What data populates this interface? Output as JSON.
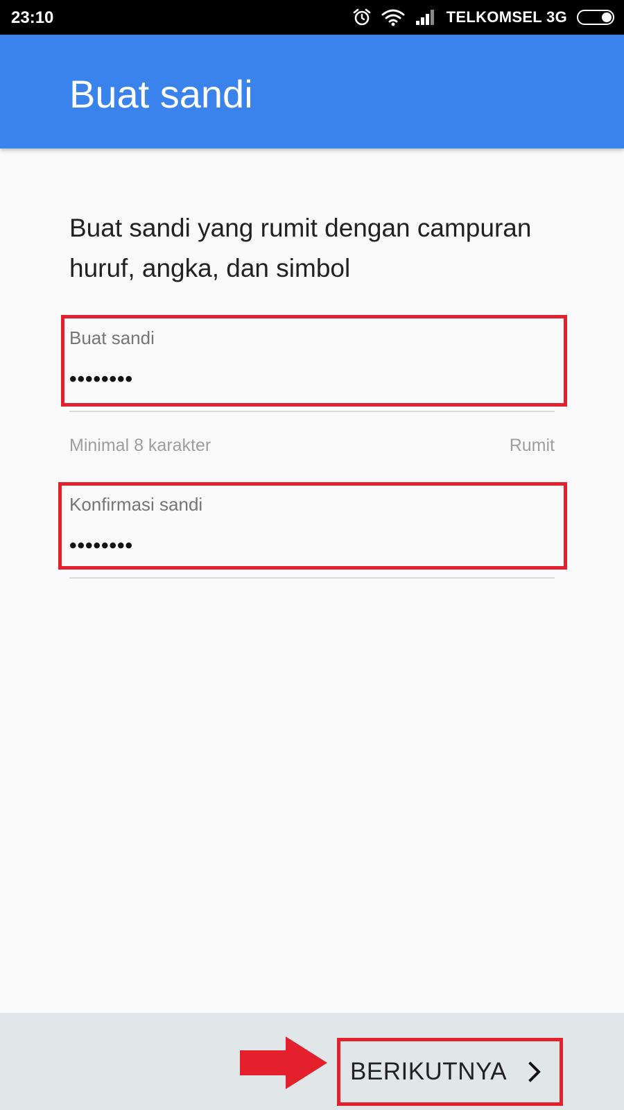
{
  "status_bar": {
    "time": "23:10",
    "carrier": "TELKOMSEL 3G",
    "icons": [
      "alarm-icon",
      "wifi-icon",
      "signal-icon",
      "battery-icon"
    ]
  },
  "header": {
    "title": "Buat sandi"
  },
  "main": {
    "instructions": "Buat sandi yang rumit dengan campuran huruf, angka, dan simbol",
    "password_field": {
      "label": "Buat sandi",
      "value": "••••••••"
    },
    "helper_left": "Minimal 8 karakter",
    "helper_right": "Rumit",
    "confirm_field": {
      "label": "Konfirmasi sandi",
      "value": "••••••••"
    }
  },
  "footer": {
    "next_label": "BERIKUTNYA"
  },
  "colors": {
    "app_bar": "#3b83ec",
    "highlight": "#e3202c",
    "background": "#fafafa",
    "footer": "#e1e6e8"
  }
}
